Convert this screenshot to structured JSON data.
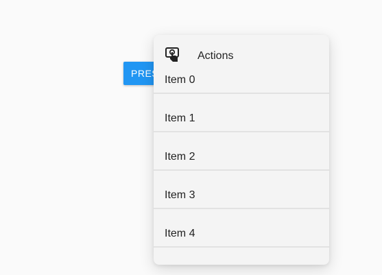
{
  "button": {
    "label": "PRESS ME",
    "color": "#2196f3"
  },
  "menu": {
    "header": {
      "icon": "touch-app-icon",
      "label": "Actions"
    },
    "items": [
      {
        "label": "Item 0"
      },
      {
        "label": "Item 1"
      },
      {
        "label": "Item 2"
      },
      {
        "label": "Item 3"
      },
      {
        "label": "Item 4"
      }
    ]
  }
}
